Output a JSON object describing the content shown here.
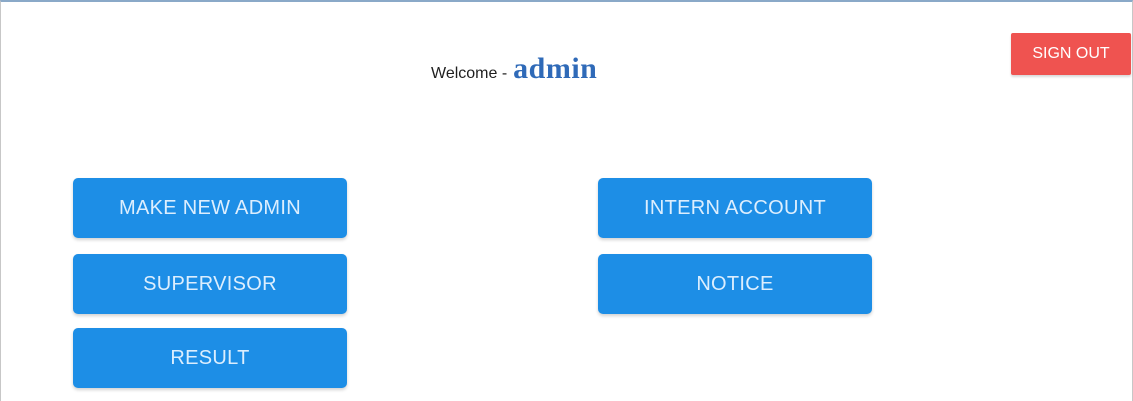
{
  "header": {
    "welcome_label": "Welcome -",
    "username": "admin",
    "signout_label": "SIGN OUT"
  },
  "menu": {
    "make_new_admin": "MAKE NEW ADMIN",
    "supervisor": "SUPERVISOR",
    "result": "RESULT",
    "intern_account": "INTERN ACCOUNT",
    "notice": "NOTICE"
  },
  "colors": {
    "primary_button": "#1d8ee6",
    "signout_button": "#ef5350",
    "username": "#2f6ab8"
  }
}
